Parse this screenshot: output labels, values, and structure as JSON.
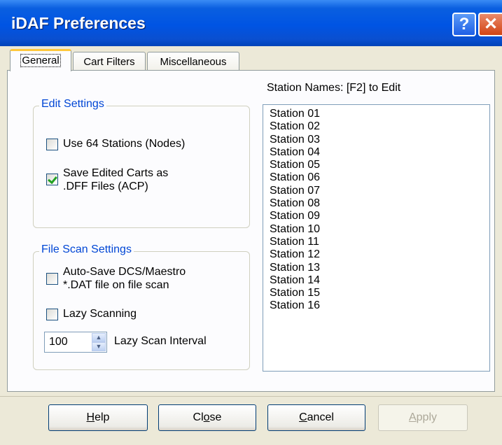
{
  "window": {
    "title": "iDAF Preferences"
  },
  "tabs": [
    {
      "label": "General",
      "active": true
    },
    {
      "label": "Cart Filters",
      "active": false
    },
    {
      "label": "Miscellaneous",
      "active": false
    }
  ],
  "edit_settings": {
    "legend": "Edit Settings",
    "use64": {
      "label": "Use 64 Stations (Nodes)",
      "checked": false
    },
    "save_edited": {
      "line1": "Save Edited Carts as",
      "line2": ".DFF Files (ACP)",
      "checked": true
    }
  },
  "file_scan": {
    "legend": "File Scan Settings",
    "autosave": {
      "line1": "Auto-Save DCS/Maestro",
      "line2": "*.DAT file on file scan",
      "checked": false
    },
    "lazy": {
      "label": "Lazy Scanning",
      "checked": false
    },
    "interval": {
      "value": "100",
      "label": "Lazy Scan Interval"
    }
  },
  "stations": {
    "caption": "Station Names:  [F2] to Edit",
    "items": [
      "Station 01",
      "Station 02",
      "Station 03",
      "Station 04",
      "Station 05",
      "Station 06",
      "Station 07",
      "Station 08",
      "Station 09",
      "Station 10",
      "Station 11",
      "Station 12",
      "Station 13",
      "Station 14",
      "Station 15",
      "Station 16"
    ]
  },
  "buttons": {
    "help": {
      "mnemonic": "H",
      "rest": "elp"
    },
    "close": {
      "pre": "Cl",
      "mnemonic": "o",
      "rest": "se"
    },
    "cancel": {
      "mnemonic": "C",
      "rest": "ancel"
    },
    "apply": {
      "mnemonic": "A",
      "rest": "pply"
    }
  },
  "colors": {
    "title_bar": "#0054e3",
    "group_legend": "#0046d5",
    "check_mark": "#21a121",
    "tab_highlight": "#ffc83c"
  }
}
